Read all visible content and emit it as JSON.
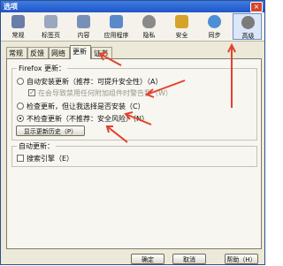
{
  "window": {
    "title": "选项",
    "close": "×"
  },
  "toolbar": {
    "items": [
      {
        "label": "常规",
        "icon": "switch-icon",
        "color": "#6a7ca8"
      },
      {
        "label": "标签页",
        "icon": "tabs-icon",
        "color": "#9aa7be"
      },
      {
        "label": "内容",
        "icon": "content-icon",
        "color": "#7a8fb6"
      },
      {
        "label": "应用程序",
        "icon": "applications-icon",
        "color": "#5b88c8"
      },
      {
        "label": "隐私",
        "icon": "mask-icon",
        "color": "#8a8a8a"
      },
      {
        "label": "安全",
        "icon": "lock-icon",
        "color": "#d4a42a"
      },
      {
        "label": "同步",
        "icon": "sync-icon",
        "color": "#4d8fd6"
      },
      {
        "label": "高级",
        "icon": "gear-icon",
        "color": "#7b7b7b"
      }
    ]
  },
  "tabs": [
    "常规",
    "反馈",
    "网络",
    "更新",
    "证书"
  ],
  "firefox_updates": {
    "title": "Firefox 更新：",
    "option_auto": "自动安装更新（推荐：可提升安全性）（A）",
    "option_auto_warn": "在会导致禁用任何附加组件时警告我（W）",
    "option_check": "检查更新，但让我选择是否安装（C）",
    "option_never": "不检查更新（不推荐：安全风险）（N）",
    "show_history": "显示更新历史（P）"
  },
  "auto_update": {
    "title": "自动更新：",
    "search_engines": "搜索引擎（E）"
  },
  "buttons": {
    "ok": "确定",
    "cancel": "取消",
    "help": "帮助（H）"
  }
}
